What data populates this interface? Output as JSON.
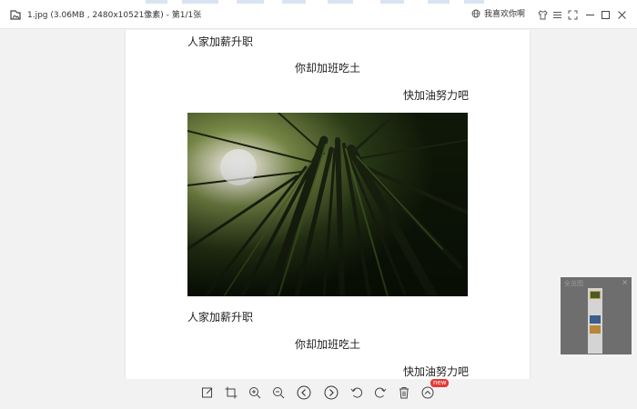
{
  "window": {
    "title": "1.jpg (3.06MB , 2480x10521像素) - 第1/1张",
    "favorite_label": "我喜欢你啊"
  },
  "document": {
    "lines": [
      "人家加薪升职",
      "你却加班吃土",
      "快加油努力吧",
      "人家加薪升职",
      "你却加班吃土",
      "快加油努力吧"
    ],
    "photo": "bamboo-forest-photo"
  },
  "navigator": {
    "title": "全览图",
    "close": "×"
  },
  "toolbar": {
    "new_badge": "new",
    "tools": [
      "edit-icon",
      "crop-icon",
      "zoom-in-icon",
      "zoom-out-icon",
      "previous-icon",
      "next-icon",
      "rotate-left-icon",
      "rotate-right-icon",
      "delete-icon",
      "more-icon"
    ]
  },
  "colors": {
    "accent": "#e53935",
    "canvas": "#f2f2f2",
    "navigator": "#6e6e6e"
  }
}
